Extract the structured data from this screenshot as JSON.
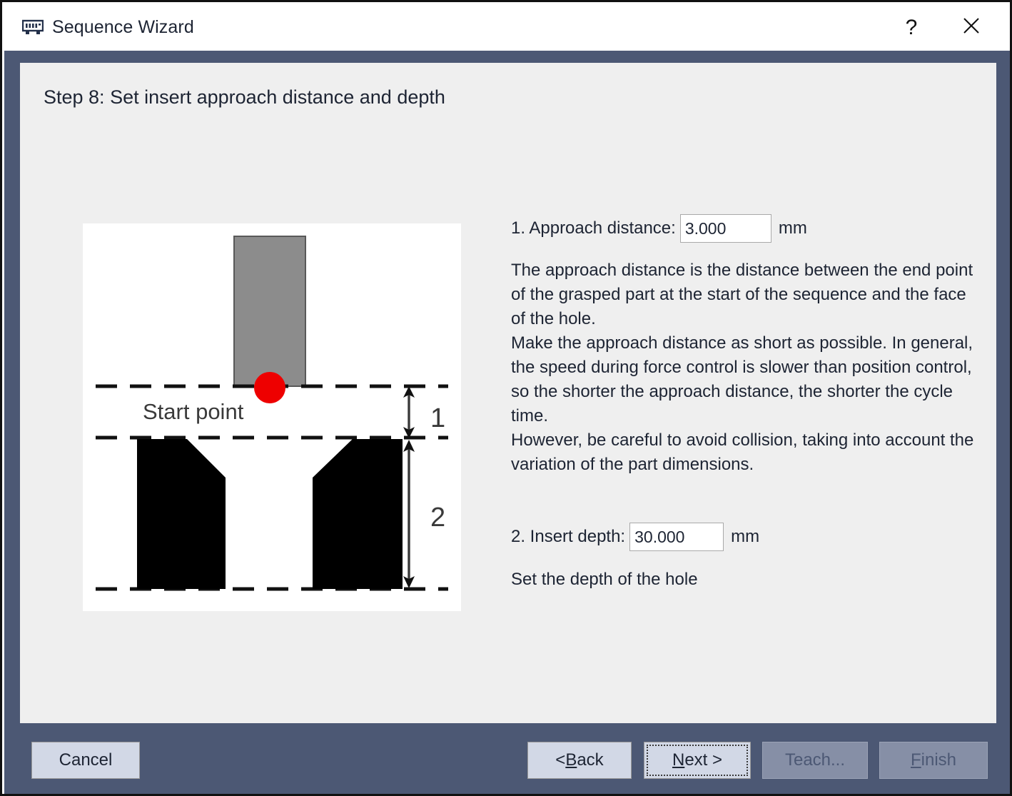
{
  "window": {
    "title": "Sequence Wizard",
    "icon": "memory-module-icon",
    "help_label": "?",
    "close_label": "✕"
  },
  "content": {
    "step_title": "Step 8: Set insert approach distance and depth"
  },
  "diagram": {
    "name": "insert-approach-diagram",
    "start_point_label": "Start point",
    "dimension_1_label": "1",
    "dimension_2_label": "2",
    "colors": {
      "part": "#8c8c8c",
      "part_outline": "#595959",
      "start_point": "#ee0000",
      "hole_material": "#000000",
      "dash_line": "#111111",
      "background": "#ffffff"
    }
  },
  "settings": {
    "approach": {
      "label": "1. Approach distance:",
      "value": "3.000",
      "placeholder": "0.000",
      "unit": "mm",
      "description": "The approach distance is the distance between the end point of the grasped part at the start of the sequence and the face of the hole.\nMake the approach distance as short as possible. In general, the speed during force control is slower than position control, so the shorter the approach distance, the shorter the cycle time.\nHowever, be careful to avoid collision, taking into account the variation of the part dimensions."
    },
    "insert_depth": {
      "label": "2. Insert depth:",
      "value": "30.000",
      "placeholder": "0.000",
      "unit": "mm",
      "description": "Set the depth of the hole"
    }
  },
  "footer": {
    "cancel": "Cancel",
    "back_prefix": "< ",
    "back_accel": "B",
    "back_suffix": "ack",
    "next_accel": "N",
    "next_suffix": "ext >",
    "teach": "Teach...",
    "finish_accel": "F",
    "finish_suffix": "inish"
  },
  "colors": {
    "frame": "#111111",
    "dialog_background": "#4c5874",
    "content_background": "#efefef",
    "button_face": "#d2d8e6",
    "button_disabled": "#868fa6",
    "text": "#1d2433"
  }
}
